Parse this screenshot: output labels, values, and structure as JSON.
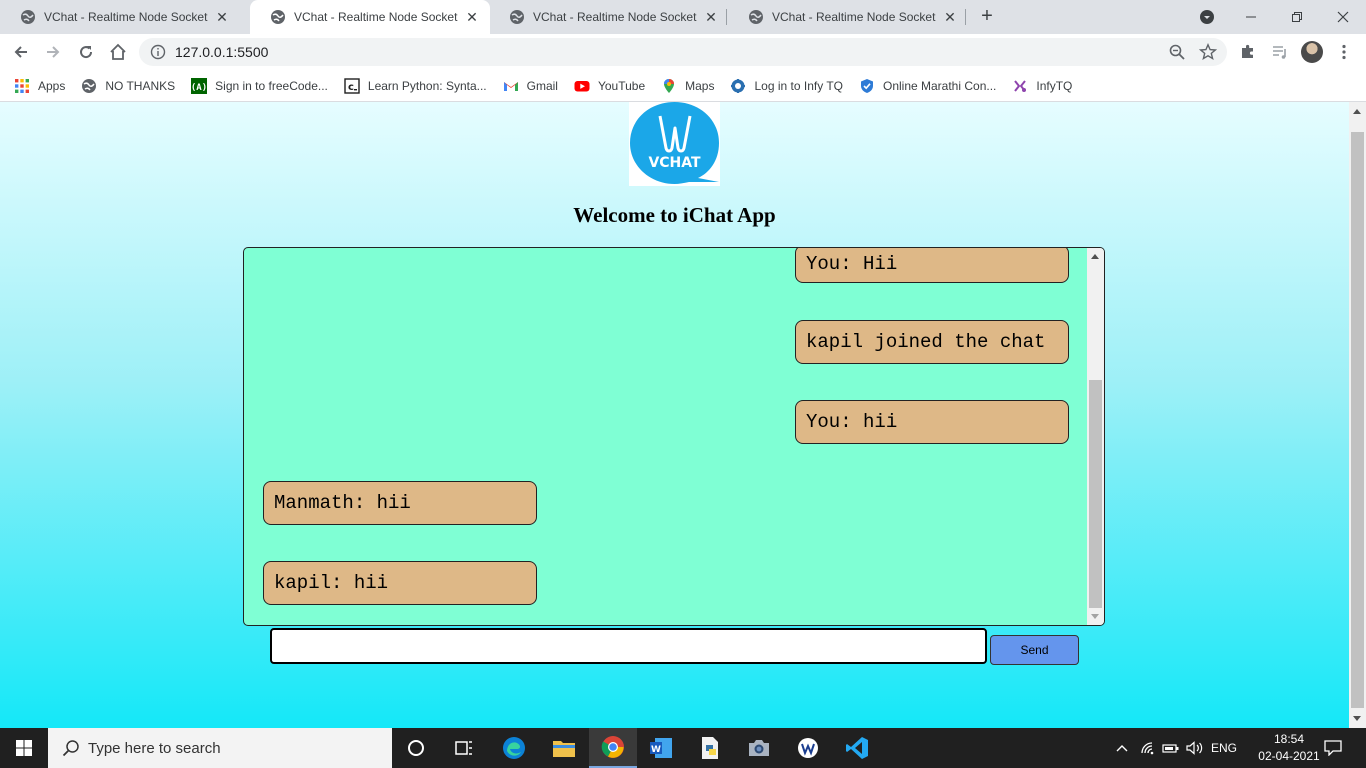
{
  "browser": {
    "tabs": [
      {
        "title": "VChat - Realtime Node Socket.io",
        "active": false
      },
      {
        "title": "VChat - Realtime Node Socket.io",
        "active": true
      },
      {
        "title": "VChat - Realtime Node Socket.io",
        "active": false
      },
      {
        "title": "VChat - Realtime Node Socket.io",
        "active": false
      }
    ],
    "new_tab_label": "+",
    "url": "127.0.0.1:5500",
    "bookmarks": [
      {
        "label": "Apps",
        "icon": "apps-grid-icon"
      },
      {
        "label": "NO THANKS",
        "icon": "globe-icon"
      },
      {
        "label": "Sign in to freeCode...",
        "icon": "freecodecamp-icon"
      },
      {
        "label": "Learn Python: Synta...",
        "icon": "codecademy-icon"
      },
      {
        "label": "Gmail",
        "icon": "gmail-icon"
      },
      {
        "label": "YouTube",
        "icon": "youtube-icon"
      },
      {
        "label": "Maps",
        "icon": "maps-pin-icon"
      },
      {
        "label": "Log in to Infy TQ",
        "icon": "infy-icon"
      },
      {
        "label": "Online Marathi Con...",
        "icon": "shield-icon"
      },
      {
        "label": "InfyTQ",
        "icon": "infytq-icon"
      }
    ]
  },
  "page": {
    "logo_text": "VCHAT",
    "title": "Welcome to iChat App",
    "messages": [
      {
        "text": "You: Hii",
        "side": "right"
      },
      {
        "text": "kapil joined the chat",
        "side": "right"
      },
      {
        "text": "You: hii",
        "side": "right"
      },
      {
        "text": "Manmath: hii",
        "side": "left"
      },
      {
        "text": "kapil: hii",
        "side": "left"
      }
    ],
    "input_value": "",
    "input_placeholder": "",
    "send_label": "Send",
    "colors": {
      "chat_background": "#7fffd4",
      "message_bubble": "#deb887",
      "send_button": "#6495ed",
      "logo_blue": "#1ba7e8"
    }
  },
  "taskbar": {
    "search_placeholder": "Type here to search",
    "language": "ENG",
    "time": "18:54",
    "date": "02-04-2021"
  }
}
